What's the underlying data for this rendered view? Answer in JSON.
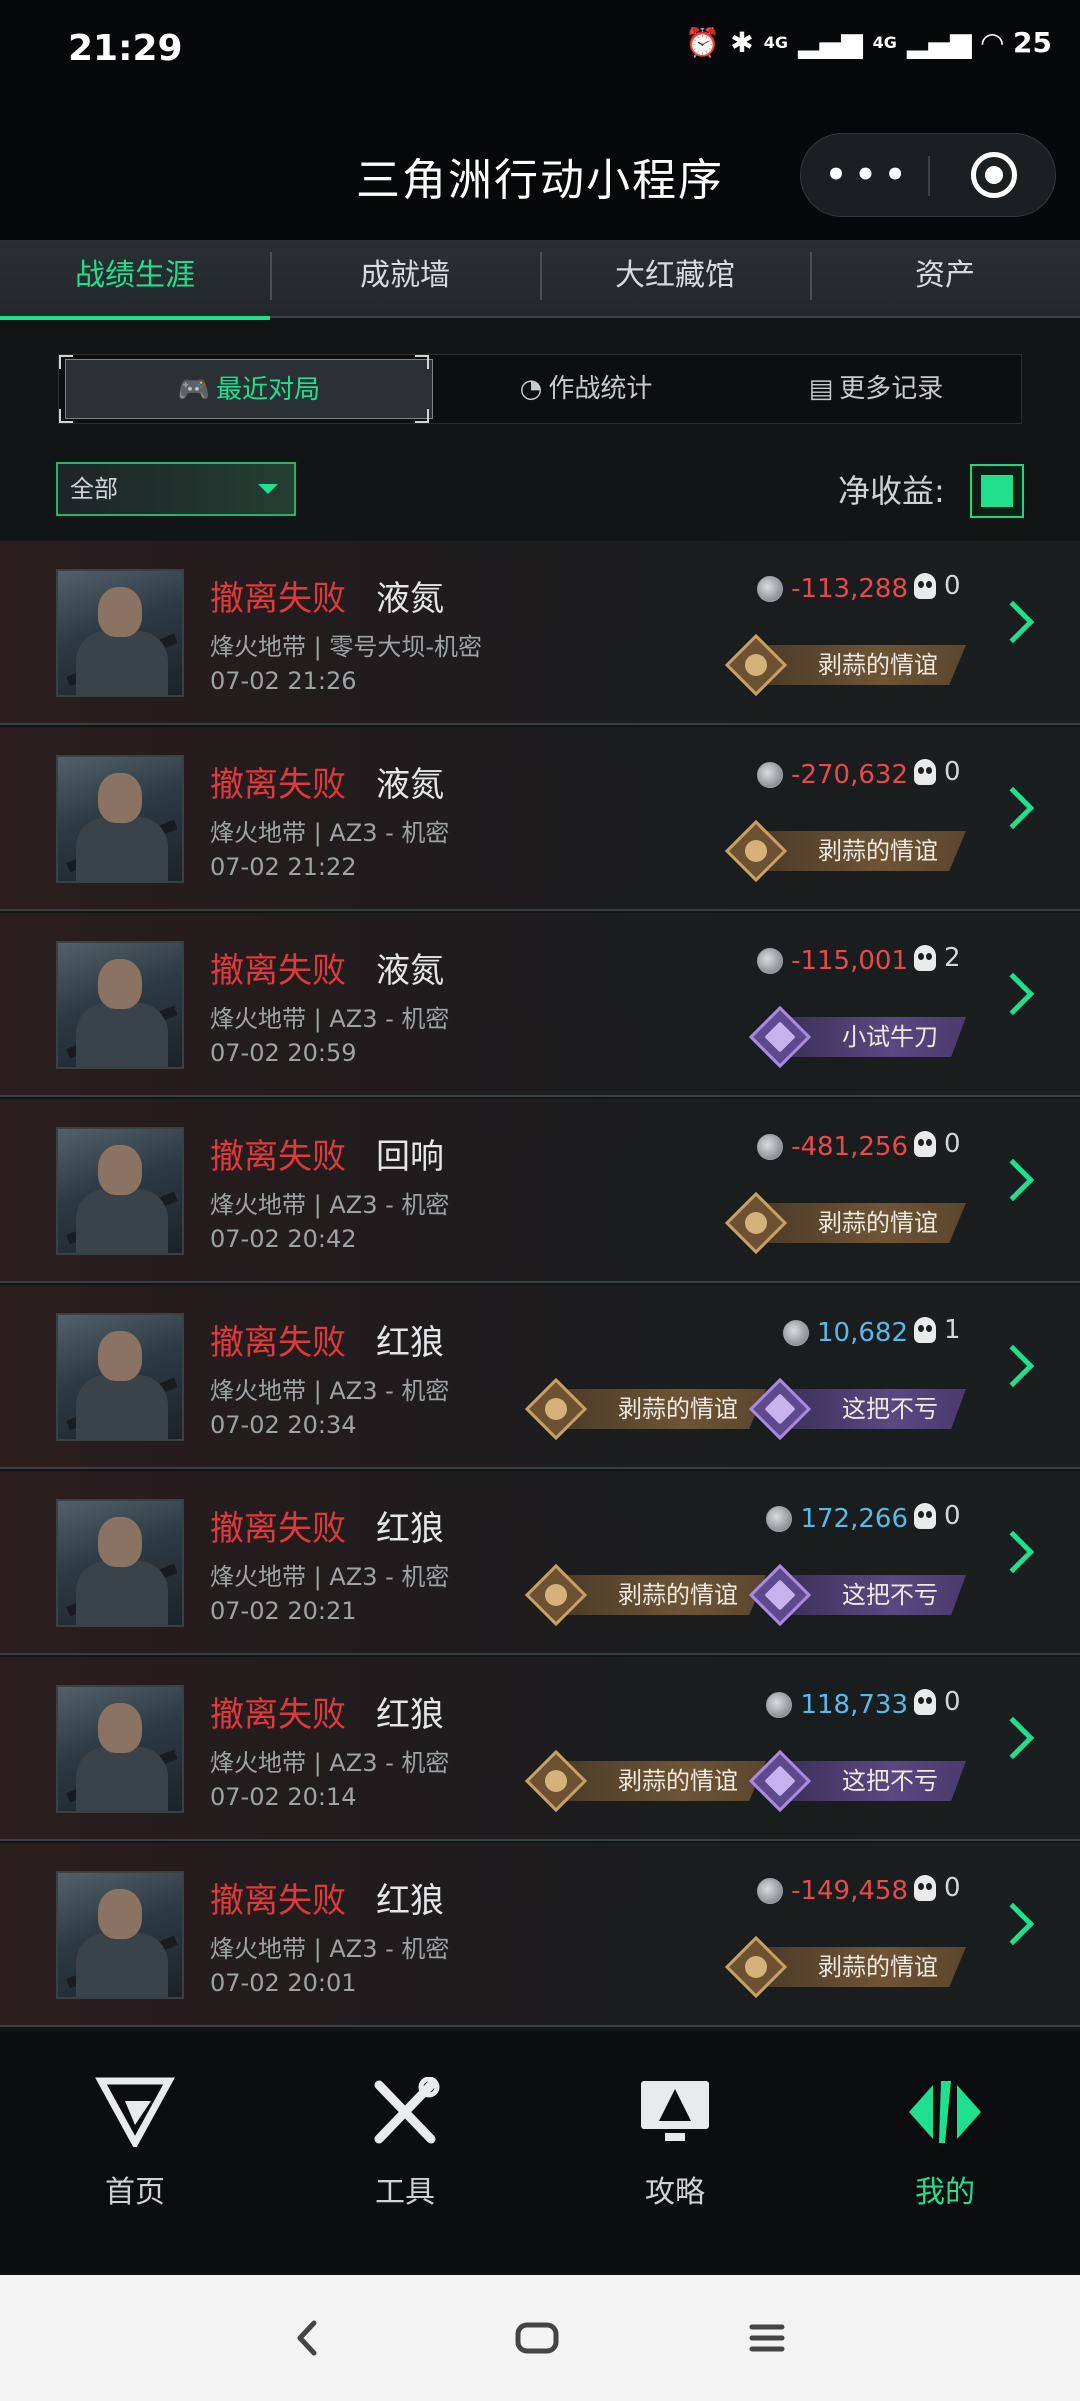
{
  "status_bar": {
    "time": "21:29",
    "battery": "25",
    "network1": "4G",
    "network2": "4G"
  },
  "header": {
    "title": "三角洲行动小程序",
    "menu_icon": "more-dots-icon",
    "close_icon": "target-close-icon"
  },
  "tabs": [
    {
      "label": "战绩生涯",
      "active": true
    },
    {
      "label": "成就墙"
    },
    {
      "label": "大红藏馆"
    },
    {
      "label": "资产"
    }
  ],
  "segments": [
    {
      "label": "最近对局",
      "icon": "gamepad-icon",
      "active": true
    },
    {
      "label": "作战统计",
      "icon": "pie-chart-icon"
    },
    {
      "label": "更多记录",
      "icon": "document-icon"
    }
  ],
  "filter": {
    "label": "全部"
  },
  "net_income": {
    "label": "净收益:",
    "checked": true
  },
  "matches": [
    {
      "status": "撤离失败",
      "operator": "液氮",
      "map": "烽火地带 | 零号大坝-机密",
      "date": "07-02 21:26",
      "money": "-113,288",
      "kills": "0",
      "badges": [
        {
          "label": "剥蒜的情谊",
          "type": "gold"
        }
      ]
    },
    {
      "status": "撤离失败",
      "operator": "液氮",
      "map": "烽火地带 | AZ3 - 机密",
      "date": "07-02 21:22",
      "money": "-270,632",
      "kills": "0",
      "badges": [
        {
          "label": "剥蒜的情谊",
          "type": "gold"
        }
      ]
    },
    {
      "status": "撤离失败",
      "operator": "液氮",
      "map": "烽火地带 | AZ3 - 机密",
      "date": "07-02 20:59",
      "money": "-115,001",
      "kills": "2",
      "badges": [
        {
          "label": "小试牛刀",
          "type": "purple"
        }
      ]
    },
    {
      "status": "撤离失败",
      "operator": "回响",
      "map": "烽火地带 | AZ3 - 机密",
      "date": "07-02 20:42",
      "money": "-481,256",
      "kills": "0",
      "badges": [
        {
          "label": "剥蒜的情谊",
          "type": "gold"
        }
      ]
    },
    {
      "status": "撤离失败",
      "operator": "红狼",
      "map": "烽火地带 | AZ3 - 机密",
      "date": "07-02 20:34",
      "money": "10,682",
      "kills": "1",
      "badges": [
        {
          "label": "剥蒜的情谊",
          "type": "gold"
        },
        {
          "label": "这把不亏",
          "type": "purple"
        }
      ]
    },
    {
      "status": "撤离失败",
      "operator": "红狼",
      "map": "烽火地带 | AZ3 - 机密",
      "date": "07-02 20:21",
      "money": "172,266",
      "kills": "0",
      "badges": [
        {
          "label": "剥蒜的情谊",
          "type": "gold"
        },
        {
          "label": "这把不亏",
          "type": "purple"
        }
      ]
    },
    {
      "status": "撤离失败",
      "operator": "红狼",
      "map": "烽火地带 | AZ3 - 机密",
      "date": "07-02 20:14",
      "money": "118,733",
      "kills": "0",
      "badges": [
        {
          "label": "剥蒜的情谊",
          "type": "gold"
        },
        {
          "label": "这把不亏",
          "type": "purple"
        }
      ]
    },
    {
      "status": "撤离失败",
      "operator": "红狼",
      "map": "烽火地带 | AZ3 - 机密",
      "date": "07-02 20:01",
      "money": "-149,458",
      "kills": "0",
      "badges": [
        {
          "label": "剥蒜的情谊",
          "type": "gold"
        }
      ]
    }
  ],
  "bottom_nav": [
    {
      "label": "首页",
      "icon": "home-logo-icon"
    },
    {
      "label": "工具",
      "icon": "tools-icon"
    },
    {
      "label": "攻略",
      "icon": "guide-monitor-icon"
    },
    {
      "label": "我的",
      "icon": "profile-logo-icon",
      "active": true
    }
  ],
  "colors": {
    "accent": "#1fe08e",
    "fail": "#e0393c",
    "positive": "#5bb8e8",
    "negative": "#e8494c"
  }
}
